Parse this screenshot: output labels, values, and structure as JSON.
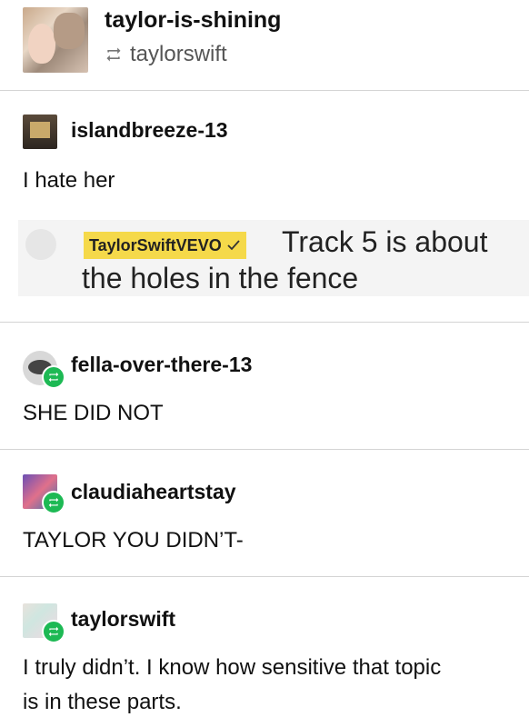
{
  "header": {
    "blog_name": "taylor-is-shining",
    "reblogged_from": "taylorswift"
  },
  "posts": [
    {
      "username": "islandbreeze-13",
      "text": "I hate her"
    },
    {
      "username": "fella-over-there-13",
      "text": "SHE DID NOT"
    },
    {
      "username": "claudiaheartstay",
      "text": "TAYLOR YOU DIDN’T-"
    },
    {
      "username": "taylorswift",
      "text_line1": "I truly didn’t. I know how sensitive that topic",
      "text_line2": "is in these parts."
    }
  ],
  "quote": {
    "handle": "TaylorSwiftVEVO",
    "line1": "Track 5 is about",
    "line2": "the holes in the fence"
  },
  "colors": {
    "reblog_badge": "#1db954",
    "highlight": "#f5d94a"
  }
}
